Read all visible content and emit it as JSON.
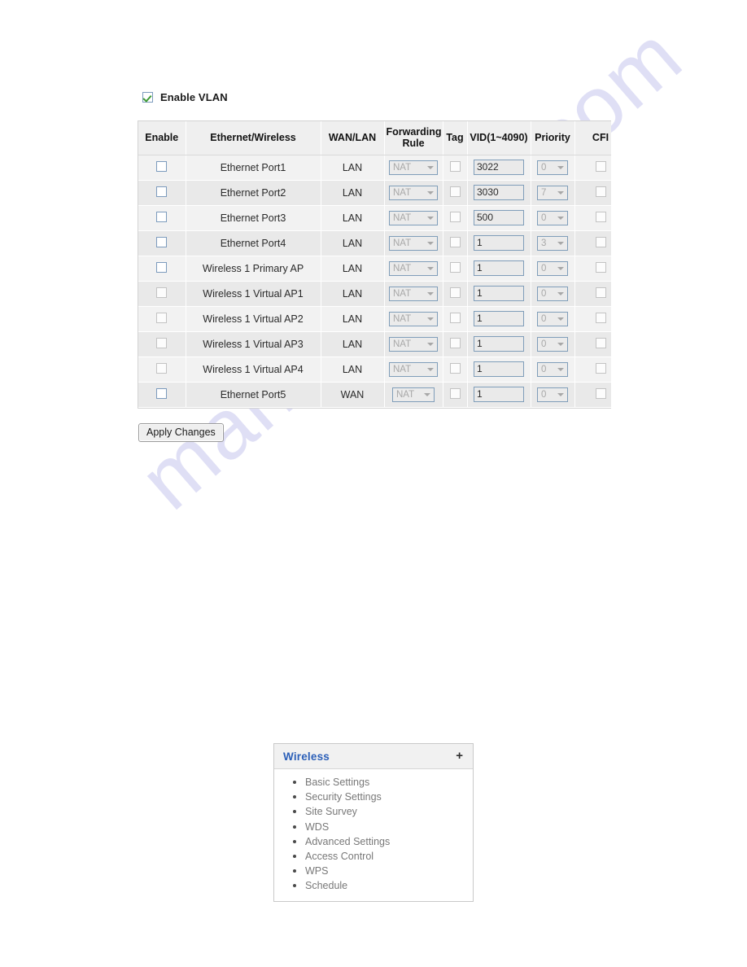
{
  "vlan": {
    "enable_vlan_label": "Enable VLAN",
    "enable_vlan_checked": true,
    "table": {
      "headers": {
        "enable": "Enable",
        "name": "Ethernet/Wireless",
        "wanlan": "WAN/LAN",
        "forwarding_rule_line1": "Forwarding",
        "forwarding_rule_line2": "Rule",
        "tag": "Tag",
        "vid": "VID(1~4090)",
        "priority": "Priority",
        "cfi": "CFI"
      },
      "rows": [
        {
          "enable_checked": false,
          "enable_disabled": false,
          "name": "Ethernet Port1",
          "indented": false,
          "wanlan": "LAN",
          "forwarding_rule": "NAT",
          "tag_checked": false,
          "vid": "3022",
          "priority": "0",
          "cfi_checked": false
        },
        {
          "enable_checked": false,
          "enable_disabled": false,
          "name": "Ethernet Port2",
          "indented": false,
          "wanlan": "LAN",
          "forwarding_rule": "NAT",
          "tag_checked": false,
          "vid": "3030",
          "priority": "7",
          "cfi_checked": false
        },
        {
          "enable_checked": false,
          "enable_disabled": false,
          "name": "Ethernet Port3",
          "indented": false,
          "wanlan": "LAN",
          "forwarding_rule": "NAT",
          "tag_checked": false,
          "vid": "500",
          "priority": "0",
          "cfi_checked": false
        },
        {
          "enable_checked": false,
          "enable_disabled": false,
          "name": "Ethernet Port4",
          "indented": false,
          "wanlan": "LAN",
          "forwarding_rule": "NAT",
          "tag_checked": false,
          "vid": "1",
          "priority": "3",
          "cfi_checked": false
        },
        {
          "enable_checked": false,
          "enable_disabled": false,
          "name": "Wireless 1 Primary AP",
          "indented": false,
          "wanlan": "LAN",
          "forwarding_rule": "NAT",
          "tag_checked": false,
          "vid": "1",
          "priority": "0",
          "cfi_checked": false
        },
        {
          "enable_checked": false,
          "enable_disabled": true,
          "name": "Wireless 1 Virtual AP1",
          "indented": true,
          "wanlan": "LAN",
          "forwarding_rule": "NAT",
          "tag_checked": false,
          "vid": "1",
          "priority": "0",
          "cfi_checked": false
        },
        {
          "enable_checked": false,
          "enable_disabled": true,
          "name": "Wireless 1 Virtual AP2",
          "indented": true,
          "wanlan": "LAN",
          "forwarding_rule": "NAT",
          "tag_checked": false,
          "vid": "1",
          "priority": "0",
          "cfi_checked": false
        },
        {
          "enable_checked": false,
          "enable_disabled": true,
          "name": "Wireless 1 Virtual AP3",
          "indented": true,
          "wanlan": "LAN",
          "forwarding_rule": "NAT",
          "tag_checked": false,
          "vid": "1",
          "priority": "0",
          "cfi_checked": false
        },
        {
          "enable_checked": false,
          "enable_disabled": true,
          "name": "Wireless 1 Virtual AP4",
          "indented": true,
          "wanlan": "LAN",
          "forwarding_rule": "NAT",
          "tag_checked": false,
          "vid": "1",
          "priority": "0",
          "cfi_checked": false
        },
        {
          "enable_checked": false,
          "enable_disabled": false,
          "name": "Ethernet Port5",
          "indented": false,
          "wanlan": "WAN",
          "forwarding_rule": "NAT",
          "tag_checked": false,
          "vid": "1",
          "priority": "0",
          "cfi_checked": false
        }
      ]
    },
    "apply_button_label": "Apply Changes"
  },
  "wireless_menu": {
    "title": "Wireless",
    "expand_icon": "+",
    "items": [
      "Basic Settings",
      "Security Settings",
      "Site Survey",
      "WDS",
      "Advanced Settings",
      "Access Control",
      "WPS",
      "Schedule"
    ]
  },
  "watermark": {
    "text": "manualshive.com"
  },
  "colors": {
    "header_bg": "#efefef",
    "row_odd": "#f2f2f2",
    "row_even": "#e9e9e9",
    "link_blue": "#2b5fb8",
    "check_green": "#3f9b34",
    "watermark": "#cdcdef"
  }
}
